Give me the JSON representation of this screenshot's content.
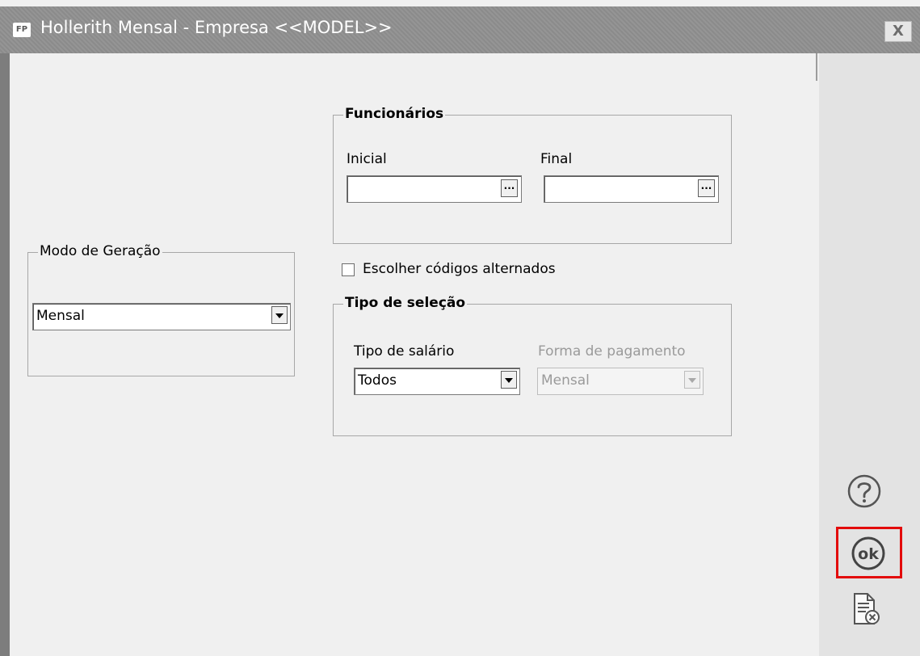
{
  "window": {
    "logo": "FP",
    "title": "Hollerith Mensal - Empresa <<MODEL>>",
    "close_label": "X"
  },
  "modo_geracao": {
    "title": "Modo de Geração",
    "value": "Mensal"
  },
  "funcionarios": {
    "title": "Funcionários",
    "inicial_label": "Inicial",
    "inicial_value": "",
    "final_label": "Final",
    "final_value": "",
    "dots_label": "..."
  },
  "escolher_codigos": {
    "label": "Escolher códigos alternados",
    "checked": false
  },
  "tipo_selecao": {
    "title": "Tipo de seleção",
    "tipo_salario_label": "Tipo de salário",
    "tipo_salario_value": "Todos",
    "forma_pagamento_label": "Forma de pagamento",
    "forma_pagamento_value": "Mensal"
  },
  "sidebar": {
    "help_icon": "question-circle-icon",
    "ok_icon": "ok-circle-icon",
    "ok_label": "ok",
    "cancel_icon": "document-cancel-icon",
    "highlight_color": "#e30b0b"
  }
}
